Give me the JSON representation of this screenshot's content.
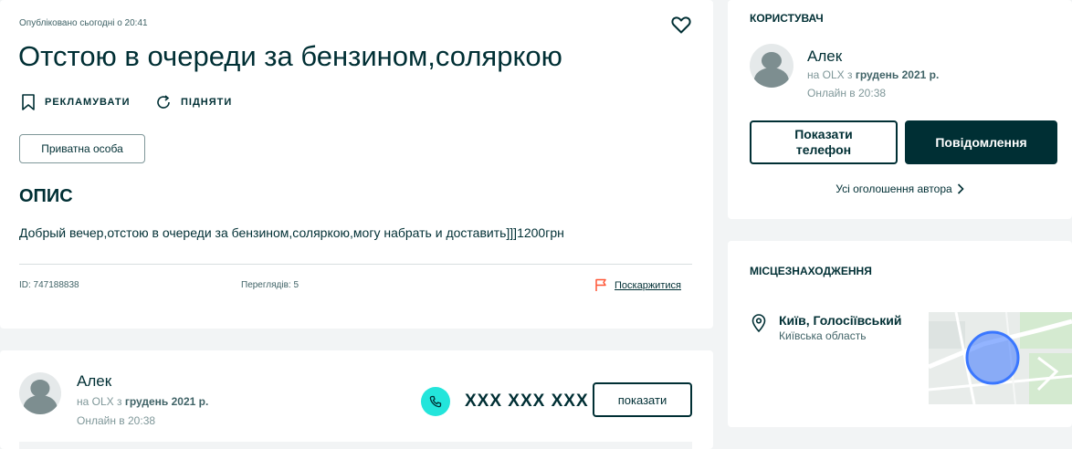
{
  "ad": {
    "published": "Опубліковано сьогодні о 20:41",
    "title": "Отстою в очереди за бензином,соляркою",
    "promote_label": "РЕКЛАМУВАТИ",
    "raise_label": "ПІДНЯТИ",
    "seller_type": "Приватна особа",
    "description_heading": "ОПИС",
    "description": "Добрый вечер,отстою в очереди за бензином,соляркою,могу набрать и доставить]]]1200грн",
    "id_text": "ID: 747188838",
    "views_text": "Переглядів: 5",
    "report_label": "Поскаржитися"
  },
  "seller": {
    "name": "Алек",
    "since_prefix": "на OLX з ",
    "since_date": "грудень 2021 р.",
    "online": "Онлайн в 20:38",
    "phone": "XXX XXX XXX",
    "show_button": "показати"
  },
  "user_panel": {
    "heading": "КОРИСТУВАЧ",
    "name": "Алек",
    "since_prefix": "на OLX з ",
    "since_date": "грудень 2021 р.",
    "online": "Онлайн в 20:38",
    "show_phone_line1": "Показати",
    "show_phone_line2": "телефон",
    "message_button": "Повідомлення",
    "all_ads_link": "Усі оголошення автора"
  },
  "location": {
    "heading": "МІСЦЕЗНАХОДЖЕННЯ",
    "city": "Київ, Голосіївський",
    "region": "Київська область"
  },
  "colors": {
    "dark": "#002f34",
    "accent_teal": "#23e5db",
    "report_flag": "#ff5636",
    "map_circle": "#3a77ff"
  }
}
